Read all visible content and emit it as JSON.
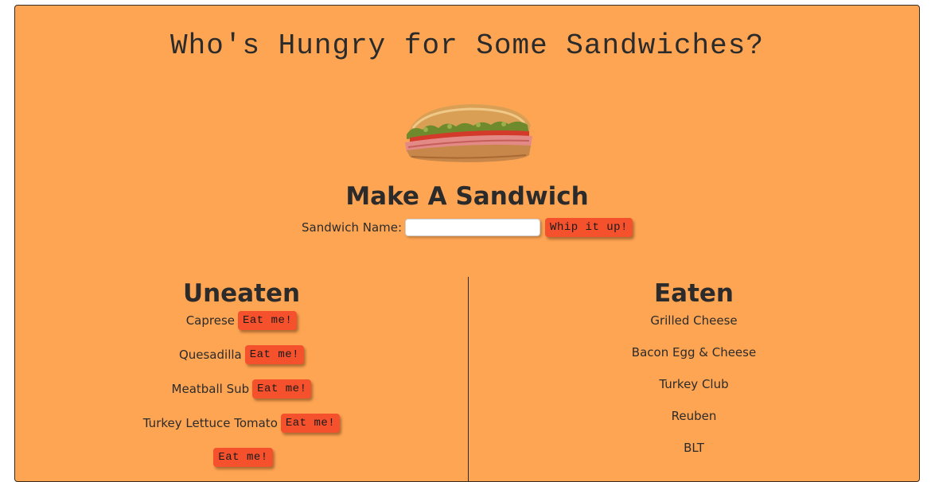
{
  "header": {
    "title": "Who's Hungry for Some Sandwiches?"
  },
  "make_form": {
    "heading": "Make A Sandwich",
    "name_label": "Sandwich Name:",
    "name_value": "",
    "submit_label": "Whip it up!"
  },
  "uneaten": {
    "heading": "Uneaten",
    "items": [
      {
        "name": "Caprese",
        "button": "Eat me!"
      },
      {
        "name": "Quesadilla",
        "button": "Eat me!"
      },
      {
        "name": "Meatball Sub",
        "button": "Eat me!"
      },
      {
        "name": "Turkey Lettuce Tomato",
        "button": "Eat me!"
      },
      {
        "name": "",
        "button": "Eat me!"
      }
    ]
  },
  "eaten": {
    "heading": "Eaten",
    "items": [
      {
        "name": "Grilled Cheese"
      },
      {
        "name": "Bacon Egg & Cheese"
      },
      {
        "name": "Turkey Club"
      },
      {
        "name": "Reuben"
      },
      {
        "name": "BLT"
      }
    ]
  },
  "colors": {
    "background": "#fea553",
    "button": "#f4512c",
    "text": "#2b2b2b"
  }
}
